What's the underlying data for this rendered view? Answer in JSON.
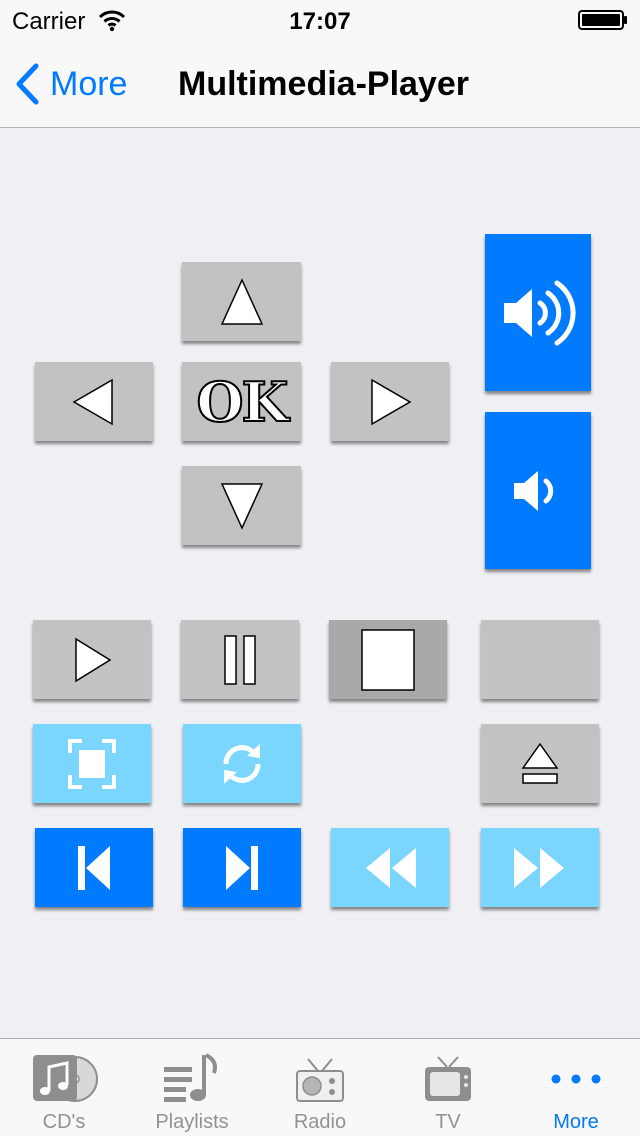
{
  "status": {
    "carrier": "Carrier",
    "time": "17:07"
  },
  "nav": {
    "back_label": "More",
    "title": "Multimedia-Player"
  },
  "remote": {
    "ok_label": "OK"
  },
  "tabs": [
    {
      "label": "CD's",
      "icon": "music-cd-icon"
    },
    {
      "label": "Playlists",
      "icon": "playlist-icon"
    },
    {
      "label": "Radio",
      "icon": "radio-icon"
    },
    {
      "label": "TV",
      "icon": "tv-icon"
    },
    {
      "label": "More",
      "icon": "more-dots-icon",
      "active": true
    }
  ],
  "colors": {
    "accent": "#007aff",
    "light_blue": "#7ad6fe",
    "button_gray": "#c2c2c2",
    "stop_gray": "#a9a9a9",
    "background": "#efeff4"
  }
}
